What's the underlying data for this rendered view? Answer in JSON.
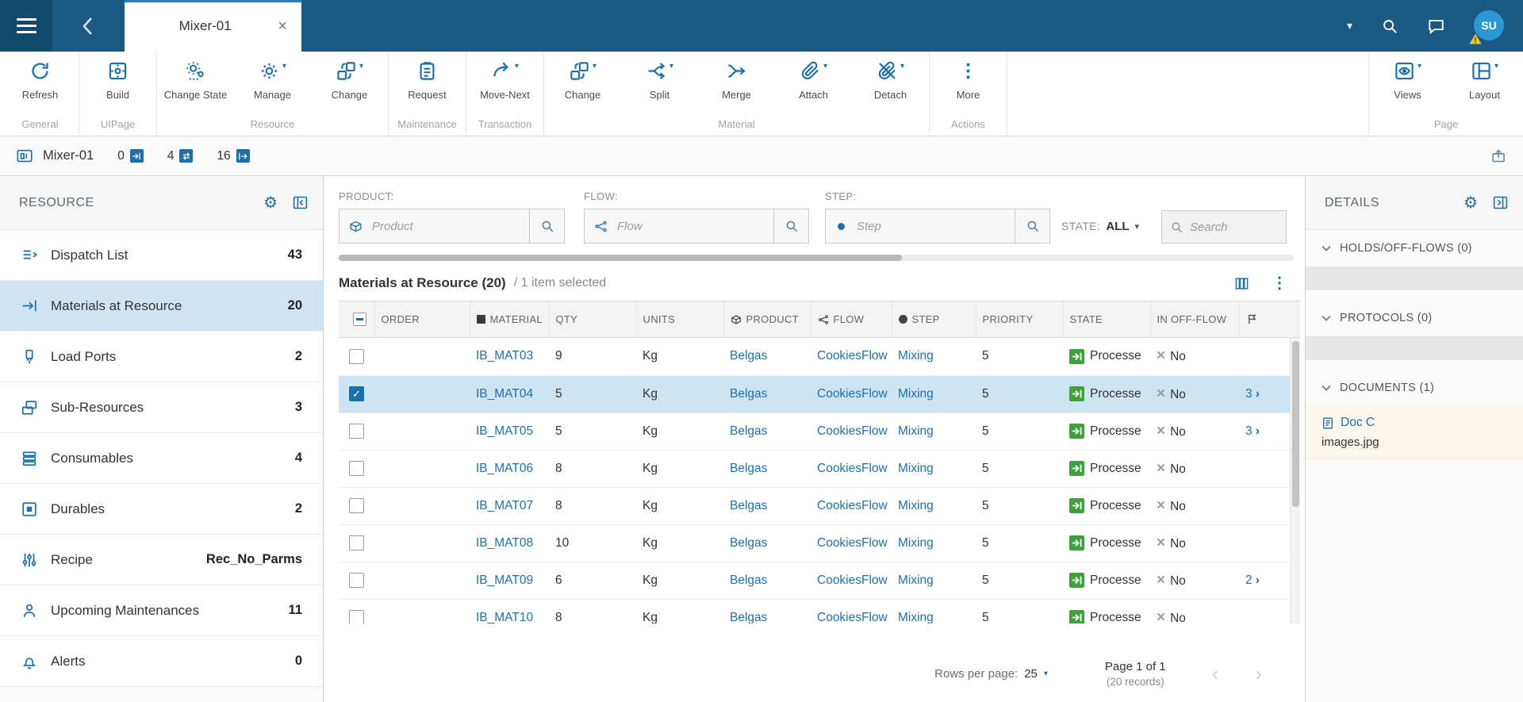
{
  "topbar": {
    "tab_title": "Mixer-01",
    "avatar_initials": "SU"
  },
  "toolbar": {
    "groups": [
      {
        "label": "General",
        "buttons": [
          {
            "label": "Refresh"
          }
        ]
      },
      {
        "label": "UIPage",
        "buttons": [
          {
            "label": "Build"
          }
        ]
      },
      {
        "label": "Resource",
        "buttons": [
          {
            "label": "Change State"
          },
          {
            "label": "Manage"
          },
          {
            "label": "Change"
          }
        ]
      },
      {
        "label": "Maintenance",
        "buttons": [
          {
            "label": "Request"
          }
        ]
      },
      {
        "label": "Transaction",
        "buttons": [
          {
            "label": "Move-Next"
          }
        ]
      },
      {
        "label": "Material",
        "buttons": [
          {
            "label": "Change"
          },
          {
            "label": "Split"
          },
          {
            "label": "Merge"
          },
          {
            "label": "Attach"
          },
          {
            "label": "Detach"
          }
        ]
      },
      {
        "label": "Actions",
        "buttons": [
          {
            "label": "More"
          }
        ]
      },
      {
        "label": "Page",
        "buttons": [
          {
            "label": "Views"
          },
          {
            "label": "Layout"
          }
        ]
      }
    ]
  },
  "subheader": {
    "title": "Mixer-01",
    "counters": [
      {
        "value": "0"
      },
      {
        "value": "4"
      },
      {
        "value": "16"
      }
    ]
  },
  "sidebar": {
    "title": "RESOURCE",
    "items": [
      {
        "label": "Dispatch List",
        "value": "43"
      },
      {
        "label": "Materials at Resource",
        "value": "20",
        "selected": true
      },
      {
        "label": "Load Ports",
        "value": "2"
      },
      {
        "label": "Sub-Resources",
        "value": "3"
      },
      {
        "label": "Consumables",
        "value": "4"
      },
      {
        "label": "Durables",
        "value": "2"
      },
      {
        "label": "Recipe",
        "value": "Rec_No_Parms"
      },
      {
        "label": "Upcoming Maintenances",
        "value": "11"
      },
      {
        "label": "Alerts",
        "value": "0"
      }
    ]
  },
  "filters": {
    "product": {
      "label": "PRODUCT:",
      "placeholder": "Product"
    },
    "flow": {
      "label": "FLOW:",
      "placeholder": "Flow"
    },
    "step": {
      "label": "STEP:",
      "placeholder": "Step"
    },
    "state": {
      "label": "STATE:",
      "value": "ALL"
    },
    "search_placeholder": "Search"
  },
  "grid": {
    "title": "Materials at Resource (20)",
    "selection_info": "/ 1 item selected",
    "columns": {
      "order": "ORDER",
      "material": "MATERIAL",
      "qty": "QTY",
      "units": "UNITS",
      "product": "PRODUCT",
      "flow": "FLOW",
      "step": "STEP",
      "priority": "PRIORITY",
      "state": "STATE",
      "in_off_flow": "IN OFF-FLOW"
    },
    "rows": [
      {
        "material": "IB_MAT03",
        "qty": "9",
        "units": "Kg",
        "product": "Belgas",
        "flow": "CookiesFlow",
        "step": "Mixing",
        "priority": "5",
        "state": "Processe",
        "in_off_flow": "No",
        "docs": ""
      },
      {
        "material": "IB_MAT04",
        "qty": "5",
        "units": "Kg",
        "product": "Belgas",
        "flow": "CookiesFlow",
        "step": "Mixing",
        "priority": "5",
        "state": "Processe",
        "in_off_flow": "No",
        "docs": "3",
        "selected": true
      },
      {
        "material": "IB_MAT05",
        "qty": "5",
        "units": "Kg",
        "product": "Belgas",
        "flow": "CookiesFlow",
        "step": "Mixing",
        "priority": "5",
        "state": "Processe",
        "in_off_flow": "No",
        "docs": "3"
      },
      {
        "material": "IB_MAT06",
        "qty": "8",
        "units": "Kg",
        "product": "Belgas",
        "flow": "CookiesFlow",
        "step": "Mixing",
        "priority": "5",
        "state": "Processe",
        "in_off_flow": "No",
        "docs": ""
      },
      {
        "material": "IB_MAT07",
        "qty": "8",
        "units": "Kg",
        "product": "Belgas",
        "flow": "CookiesFlow",
        "step": "Mixing",
        "priority": "5",
        "state": "Processe",
        "in_off_flow": "No",
        "docs": ""
      },
      {
        "material": "IB_MAT08",
        "qty": "10",
        "units": "Kg",
        "product": "Belgas",
        "flow": "CookiesFlow",
        "step": "Mixing",
        "priority": "5",
        "state": "Processe",
        "in_off_flow": "No",
        "docs": ""
      },
      {
        "material": "IB_MAT09",
        "qty": "6",
        "units": "Kg",
        "product": "Belgas",
        "flow": "CookiesFlow",
        "step": "Mixing",
        "priority": "5",
        "state": "Processe",
        "in_off_flow": "No",
        "docs": "2"
      },
      {
        "material": "IB_MAT10",
        "qty": "8",
        "units": "Kg",
        "product": "Belgas",
        "flow": "CookiesFlow",
        "step": "Mixing",
        "priority": "5",
        "state": "Processe",
        "in_off_flow": "No",
        "docs": ""
      }
    ],
    "pagination": {
      "rows_per_page_label": "Rows per page:",
      "rows_per_page": "25",
      "page": "Page 1 of 1",
      "records": "(20 records)"
    }
  },
  "details": {
    "title": "DETAILS",
    "sections": [
      {
        "label": "HOLDS/OFF-FLOWS (0)"
      },
      {
        "label": "PROTOCOLS (0)"
      },
      {
        "label": "DOCUMENTS (1)"
      }
    ],
    "document": {
      "name": "Doc C",
      "file": "images.jpg"
    }
  }
}
